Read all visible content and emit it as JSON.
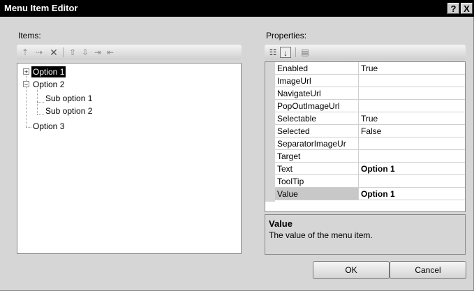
{
  "window": {
    "title": "Menu Item Editor",
    "help_button": "?",
    "close_button": "X"
  },
  "items_panel": {
    "label": "Items:",
    "toolbar": [
      {
        "icon": "add-root-item-icon",
        "glyph": "⇡"
      },
      {
        "icon": "add-child-item-icon",
        "glyph": "⇢"
      },
      {
        "icon": "delete-icon",
        "glyph": "✕"
      },
      {
        "icon": "move-up-icon",
        "glyph": "⇧"
      },
      {
        "icon": "move-down-icon",
        "glyph": "⇩"
      },
      {
        "icon": "indent-icon",
        "glyph": "⇥"
      },
      {
        "icon": "outdent-icon",
        "glyph": "⇤"
      }
    ],
    "tree": {
      "option1": "Option 1",
      "option2": "Option 2",
      "sub1": "Sub option 1",
      "sub2": "Sub option 2",
      "option3": "Option 3",
      "expander_collapsed": "+",
      "expander_expanded": "−"
    }
  },
  "properties_panel": {
    "label": "Properties:",
    "toolbar": [
      {
        "icon": "categorized-icon",
        "glyph": "☷"
      },
      {
        "icon": "alphabetical-icon",
        "glyph": "↓"
      },
      {
        "icon": "property-pages-icon",
        "glyph": "▤"
      }
    ],
    "rows": [
      {
        "name": "Enabled",
        "value": "True"
      },
      {
        "name": "ImageUrl",
        "value": ""
      },
      {
        "name": "NavigateUrl",
        "value": ""
      },
      {
        "name": "PopOutImageUrl",
        "value": ""
      },
      {
        "name": "Selectable",
        "value": "True"
      },
      {
        "name": "Selected",
        "value": "False"
      },
      {
        "name": "SeparatorImageUr",
        "value": ""
      },
      {
        "name": "Target",
        "value": ""
      },
      {
        "name": "Text",
        "value": "Option 1"
      },
      {
        "name": "ToolTip",
        "value": ""
      },
      {
        "name": "Value",
        "value": "Option 1"
      }
    ],
    "description": {
      "title": "Value",
      "text": "The value of the menu item."
    }
  },
  "buttons": {
    "ok": "OK",
    "cancel": "Cancel"
  }
}
